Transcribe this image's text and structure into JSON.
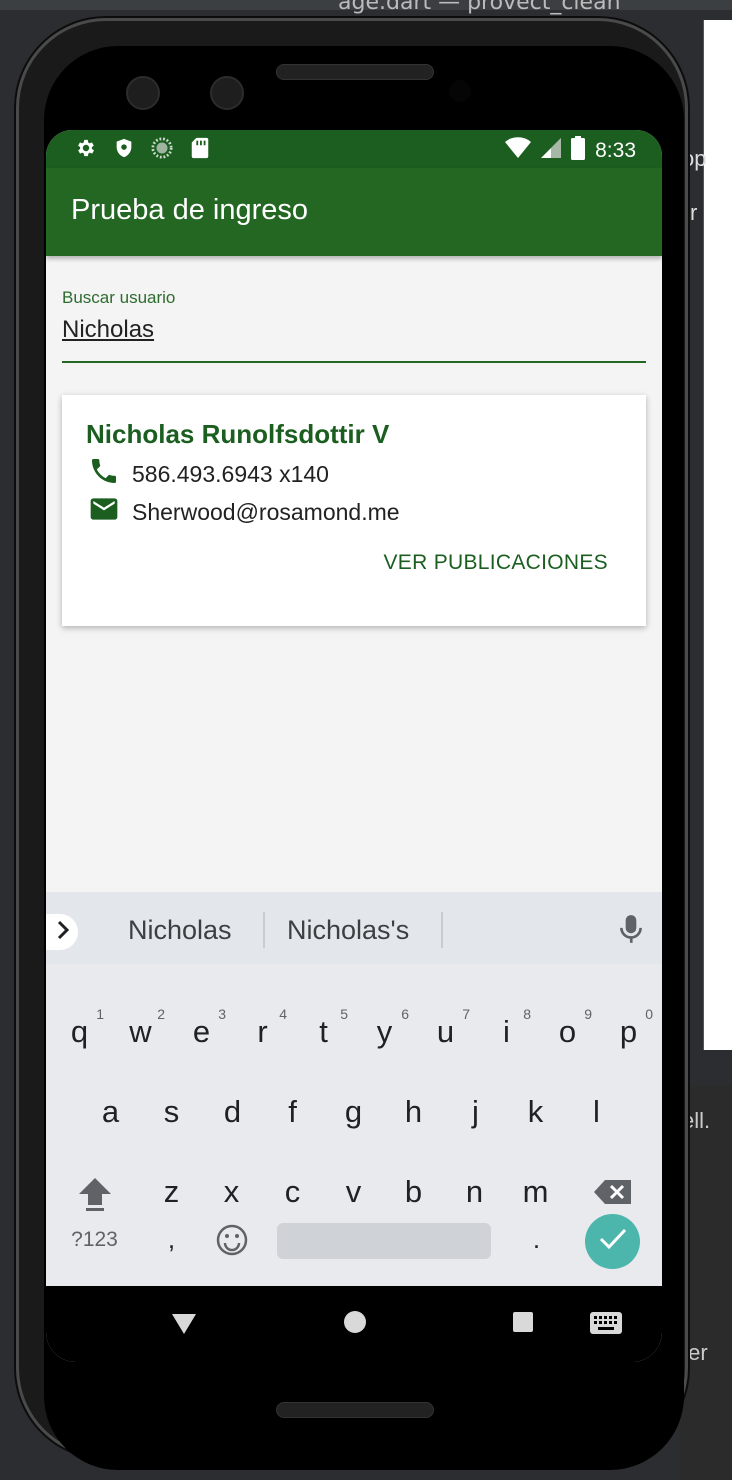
{
  "ide": {
    "title_fragment": "age.dart — provect_clean",
    "side_text_1": "ell.",
    "side_text_2": "ter",
    "frag_1": "op",
    "frag_2": "r"
  },
  "status_bar": {
    "time": "8:33"
  },
  "app_bar": {
    "title": "Prueba de ingreso"
  },
  "search": {
    "label": "Buscar usuario",
    "value": "Nicholas"
  },
  "user_card": {
    "name": "Nicholas Runolfsdottir V",
    "phone": "586.493.6943 x140",
    "email": "Sherwood@rosamond.me",
    "action_label": "VER PUBLICACIONES"
  },
  "keyboard": {
    "suggestions": [
      "Nicholas",
      "Nicholas's"
    ],
    "row1": [
      {
        "key": "q",
        "hint": "1"
      },
      {
        "key": "w",
        "hint": "2"
      },
      {
        "key": "e",
        "hint": "3"
      },
      {
        "key": "r",
        "hint": "4"
      },
      {
        "key": "t",
        "hint": "5"
      },
      {
        "key": "y",
        "hint": "6"
      },
      {
        "key": "u",
        "hint": "7"
      },
      {
        "key": "i",
        "hint": "8"
      },
      {
        "key": "o",
        "hint": "9"
      },
      {
        "key": "p",
        "hint": "0"
      }
    ],
    "row2": [
      "a",
      "s",
      "d",
      "f",
      "g",
      "h",
      "j",
      "k",
      "l"
    ],
    "row3": [
      "z",
      "x",
      "c",
      "v",
      "b",
      "n",
      "m"
    ],
    "symbols_label": "?123",
    "comma": ",",
    "period": "."
  }
}
